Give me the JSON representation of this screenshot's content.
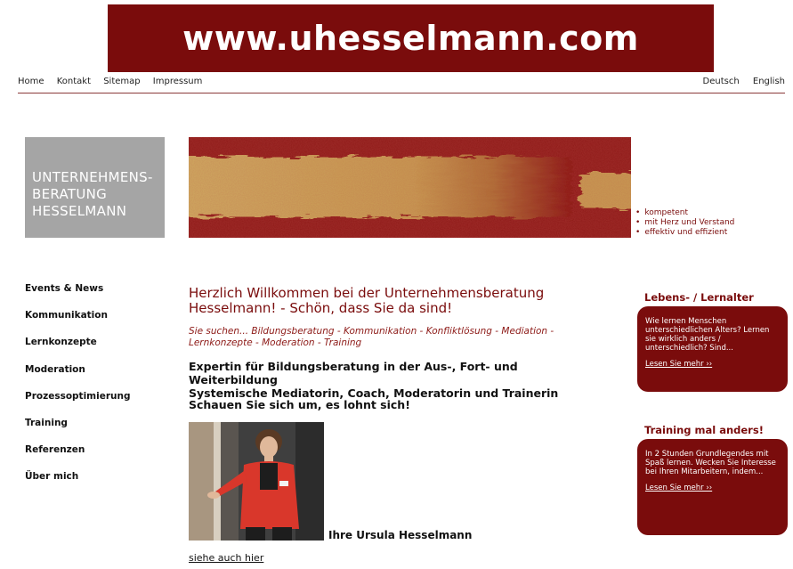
{
  "banner": {
    "text": "www.uhesselmann.com"
  },
  "topnav": {
    "items": [
      "Home",
      "Kontakt",
      "Sitemap",
      "Impressum"
    ]
  },
  "langnav": {
    "items": [
      "Deutsch",
      "English"
    ]
  },
  "logo": {
    "lines": [
      "UNTERNEHMENS-",
      "BERATUNG",
      "HESSELMANN"
    ]
  },
  "taglines": [
    "kompetent",
    "mit Herz und Verstand",
    "effektiv und effizient"
  ],
  "sidebar": {
    "items": [
      "Events & News",
      "Kommunikation",
      "Lernkonzepte",
      "Moderation",
      "Prozessoptimierung",
      "Training",
      "Referenzen",
      "Über mich"
    ]
  },
  "main": {
    "welcome": "Herzlich Willkommen bei der Unternehmensberatung Hesselmann! - Schön, dass Sie da sind!",
    "subline": "Sie suchen... Bildungsberatung - Kommunikation - Konfliktlösung - Mediation - Lernkonzepte - Moderation - Training",
    "expertin_1": "Expertin für Bildungsberatung in der Aus-, Fort- und Weiterbildung",
    "expertin_2": "Systemische Mediatorin, Coach, Moderatorin und Trainerin",
    "schauen": "Schauen Sie sich um, es lohnt sich!",
    "photo_caption": "Ihre Ursula Hesselmann",
    "siehe_link": "siehe auch hier"
  },
  "cards": [
    {
      "title": "Lebens- / Lernalter",
      "body": "Wie lernen Menschen unterschiedlichen Alters? Lernen sie wirklich anders / unterschiedlich? Sind...",
      "more": "Lesen Sie mehr ››"
    },
    {
      "title": "Training mal anders!",
      "body": "In 2 Stunden Grundlegendes mit Spaß lernen. Wecken Sie Interesse bei Ihren Mitarbeitern, indem...",
      "more": "Lesen Sie mehr ››"
    }
  ],
  "colors": {
    "brand": "#7a0c0c",
    "logo_gray": "#a5a5a5",
    "hero_gold": "#c9a25a"
  }
}
